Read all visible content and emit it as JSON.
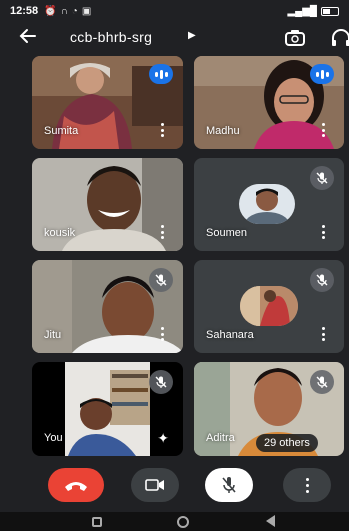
{
  "status_bar": {
    "time": "12:58"
  },
  "meeting": {
    "code": "ccb-bhrb-srg"
  },
  "participants": [
    {
      "name": "Sumita",
      "state": "speaking"
    },
    {
      "name": "Madhu",
      "state": "speaking"
    },
    {
      "name": "kousik",
      "state": "none"
    },
    {
      "name": "Soumen",
      "state": "muted"
    },
    {
      "name": "Jitu",
      "state": "muted"
    },
    {
      "name": "Sahanara",
      "state": "muted"
    },
    {
      "name": "You",
      "state": "muted"
    },
    {
      "name": "Aditra",
      "state": "muted"
    }
  ],
  "others_label": "29 others",
  "colors": {
    "end_call": "#ea4335",
    "speaking": "#1a73e8",
    "control": "#3c4043",
    "mic_off": "#ffffff"
  }
}
